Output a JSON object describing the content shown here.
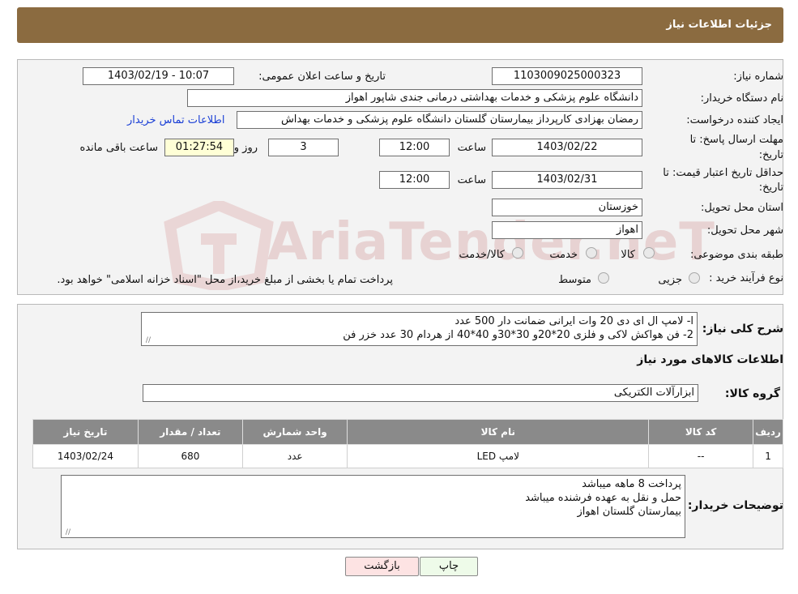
{
  "header": {
    "title": "جزئیات اطلاعات نیاز"
  },
  "form": {
    "need_number_label": "شماره نیاز:",
    "need_number": "1103009025000323",
    "announce_label": "تاریخ و ساعت اعلان عمومی:",
    "announce_value": "1403/02/19 - 10:07",
    "buyer_org_label": "نام دستگاه خریدار:",
    "buyer_org": "دانشگاه علوم پزشکی و خدمات بهداشتی درمانی جندی شاپور اهواز",
    "requester_label": "ایجاد کننده درخواست:",
    "requester": "رمضان بهزادی کارپرداز بیمارستان گلستان دانشگاه علوم پزشکی و خدمات بهداش",
    "contact_link": "اطلاعات تماس خریدار",
    "deadline_label_1": "مهلت ارسال پاسخ: تا",
    "deadline_label_2": "تاریخ:",
    "deadline_date": "1403/02/22",
    "time_label": "ساعت",
    "deadline_time": "12:00",
    "days_value": "3",
    "days_label": "روز و",
    "remaining_time": "01:27:54",
    "remaining_label": "ساعت باقی مانده",
    "validity_label_1": "حداقل تاریخ اعتبار قیمت: تا",
    "validity_label_2": "تاریخ:",
    "validity_date": "1403/02/31",
    "validity_time": "12:00",
    "province_label": "استان محل تحویل:",
    "province": "خوزستان",
    "city_label": "شهر محل تحویل:",
    "city": "اهواز",
    "category_label": "طبقه بندی موضوعی:",
    "category_options": [
      "کالا",
      "خدمت",
      "کالا/خدمت"
    ],
    "process_label": "نوع فرآیند خرید :",
    "process_options": [
      "جزیی",
      "متوسط"
    ],
    "process_note": "پرداخت تمام یا بخشی از مبلغ خرید،از محل \"اسناد خزانه اسلامی\" خواهد بود."
  },
  "details": {
    "summary_label": "شرح کلی نیاز:",
    "summary_line1": "ا- لامپ ال ای دی 20 وات ایرانی ضمانت دار 500 عدد",
    "summary_line2": "2- فن هواکش  لاکی و فلزی 20*20و 30*30و 40*40 از هردام 30 عدد خزر فن",
    "goods_info_title": "اطلاعات کالاهای مورد نیاز",
    "group_label": "گروه کالا:",
    "group_value": "ابزارآلات الکتریکی",
    "table": {
      "headers": [
        "ردیف",
        "کد کالا",
        "نام کالا",
        "واحد شمارش",
        "تعداد / مقدار",
        "تاریخ نیاز"
      ],
      "rows": [
        [
          "1",
          "--",
          "لامپ LED",
          "عدد",
          "680",
          "1403/02/24"
        ]
      ]
    },
    "buyer_notes_label": "توضیحات خریدار:",
    "buyer_notes_line1": "پرداخت 8 ماهه میباشد",
    "buyer_notes_line2": "حمل و نقل به عهده فرشنده میباشد",
    "buyer_notes_line3": "بیمارستان گلستان اهواز"
  },
  "buttons": {
    "back": "بازگشت",
    "print": "چاپ"
  },
  "watermark": {
    "text": "AriaTender.neT"
  },
  "colors": {
    "header_bg": "#8b6b40",
    "back_button_bg": "#fde3e3",
    "print_button_bg": "#eefbe9",
    "link": "#1a3fd6"
  }
}
